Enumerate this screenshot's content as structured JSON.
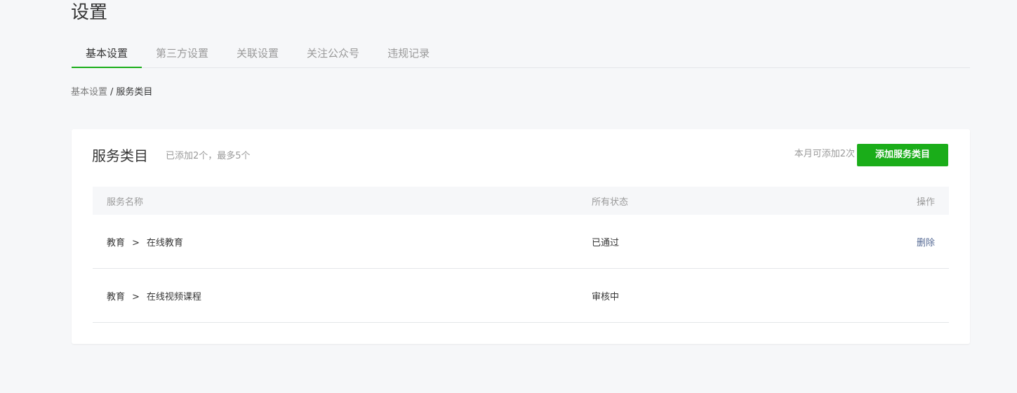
{
  "header": {
    "title": "设置"
  },
  "tabs": [
    {
      "label": "基本设置",
      "active": true
    },
    {
      "label": "第三方设置",
      "active": false
    },
    {
      "label": "关联设置",
      "active": false
    },
    {
      "label": "关注公众号",
      "active": false
    },
    {
      "label": "违规记录",
      "active": false
    }
  ],
  "breadcrumb": {
    "parent": "基本设置",
    "separator": "/",
    "current": "服务类目"
  },
  "card": {
    "title": "服务类目",
    "subtitle": "已添加2个，最多5个",
    "quota_text": "本月可添加2次",
    "add_button_label": "添加服务类目"
  },
  "table": {
    "columns": {
      "name": "服务名称",
      "status": "所有状态",
      "operation": "操作"
    },
    "rows": [
      {
        "category": "教育",
        "separator": ">",
        "subcategory": "在线教育",
        "status": "已通过",
        "operation": "删除"
      },
      {
        "category": "教育",
        "separator": ">",
        "subcategory": "在线视频课程",
        "status": "审核中",
        "operation": ""
      }
    ]
  },
  "colors": {
    "accent": "#1aad19",
    "link": "#576b95",
    "background": "#f6f7f9"
  }
}
